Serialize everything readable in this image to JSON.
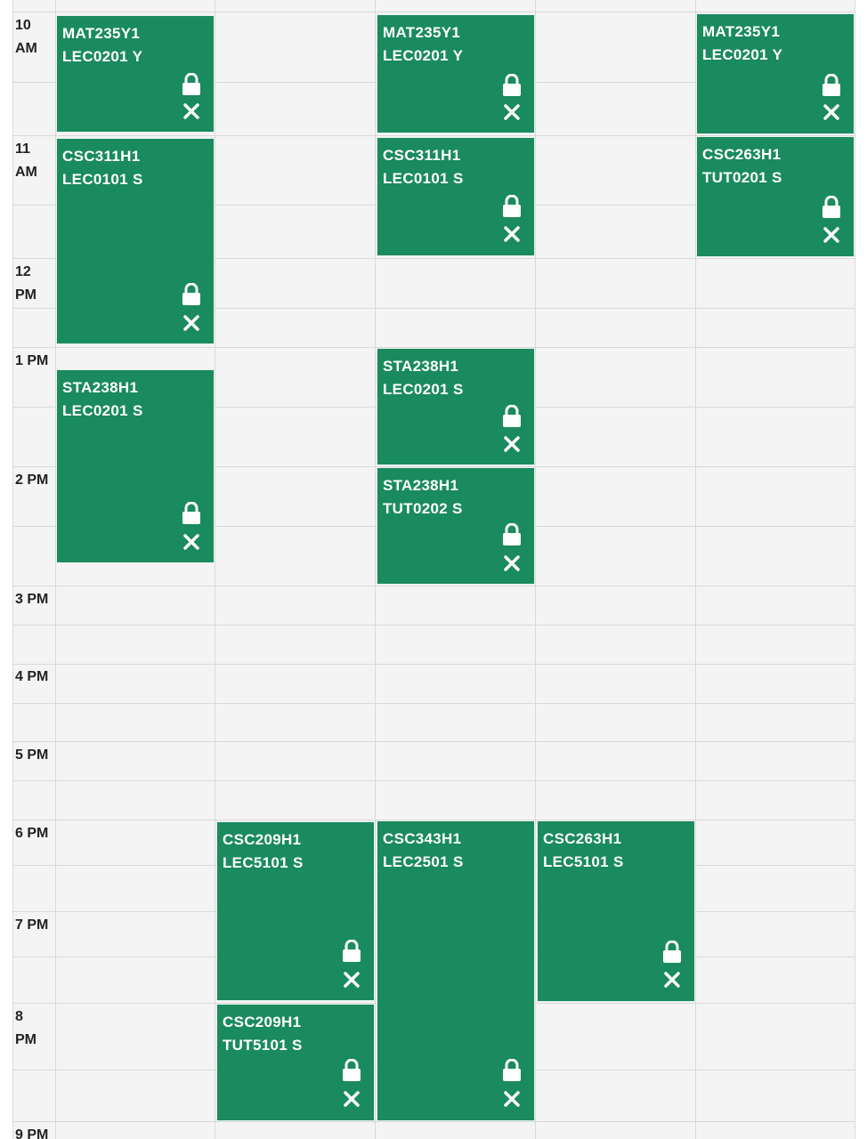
{
  "time_labels": {
    "t10": [
      "10",
      "AM"
    ],
    "t11": [
      "11",
      "AM"
    ],
    "t12": [
      "12",
      "PM"
    ],
    "t13": "1 PM",
    "t14": "2 PM",
    "t15": "3 PM",
    "t16": "4 PM",
    "t17": "5 PM",
    "t18": "6 PM",
    "t19": "7 PM",
    "t20": [
      "8",
      "PM"
    ],
    "t21": "9 PM"
  },
  "blocks": [
    {
      "code": "MAT235Y1",
      "section": "LEC0201 Y"
    },
    {
      "code": "MAT235Y1",
      "section": "LEC0201 Y"
    },
    {
      "code": "MAT235Y1",
      "section": "LEC0201 Y"
    },
    {
      "code": "CSC311H1",
      "section": "LEC0101 S"
    },
    {
      "code": "CSC311H1",
      "section": "LEC0101 S"
    },
    {
      "code": "CSC263H1",
      "section": "TUT0201 S"
    },
    {
      "code": "STA238H1",
      "section": "LEC0201 S"
    },
    {
      "code": "STA238H1",
      "section": "LEC0201 S"
    },
    {
      "code": "STA238H1",
      "section": "TUT0202 S"
    },
    {
      "code": "CSC209H1",
      "section": "LEC5101 S"
    },
    {
      "code": "CSC343H1",
      "section": "LEC2501 S"
    },
    {
      "code": "CSC263H1",
      "section": "LEC5101 S"
    },
    {
      "code": "CSC209H1",
      "section": "TUT5101 S"
    }
  ],
  "colors": {
    "block": "#1a8a5f",
    "grid_bg": "#f4f4f4",
    "grid_line": "#d9d9d9"
  },
  "icons": {
    "lock": "lock-icon",
    "remove": "close-icon"
  }
}
